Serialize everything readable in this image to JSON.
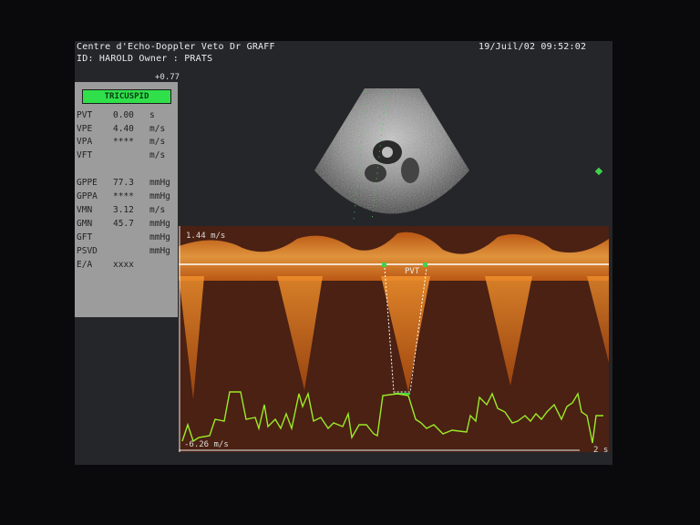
{
  "header": {
    "clinic": "Centre d'Echo-Doppler Veto Dr GRAFF",
    "datetime": "19/Juil/02 09:52:02",
    "patient": "ID: HAROLD Owner : PRATS"
  },
  "scale_top": "+0.77",
  "mode_label": "TRICUSPID",
  "measurements": [
    {
      "label": "PVT",
      "value": "0.00",
      "unit": "s"
    },
    {
      "label": "VPE",
      "value": "4.40",
      "unit": "m/s"
    },
    {
      "label": "VPA",
      "value": "****",
      "unit": "m/s"
    },
    {
      "label": "VFT",
      "value": "",
      "unit": "m/s"
    },
    {
      "label": "GPPE",
      "value": "77.3",
      "unit": "mmHg"
    },
    {
      "label": "GPPA",
      "value": "****",
      "unit": "mmHg"
    },
    {
      "label": "VMN",
      "value": "3.12",
      "unit": "m/s"
    },
    {
      "label": "GMN",
      "value": "45.7",
      "unit": "mmHg"
    },
    {
      "label": "GFT",
      "value": "",
      "unit": "mmHg"
    },
    {
      "label": "PSVD",
      "value": "",
      "unit": "mmHg"
    },
    {
      "label": "E/A",
      "value": "xxxx",
      "unit": ""
    }
  ],
  "doppler": {
    "top_scale": "1.44 m/s",
    "bottom_scale": "-6.26 m/s",
    "time_label": "2 s",
    "cursor_label": "PVT"
  },
  "colors": {
    "doppler_signal": "#e0781c",
    "baseline": "#ffffff",
    "ecg_trace": "#9bea28",
    "marker": "#3fd24a",
    "mode_badge": "#2fe04a"
  }
}
